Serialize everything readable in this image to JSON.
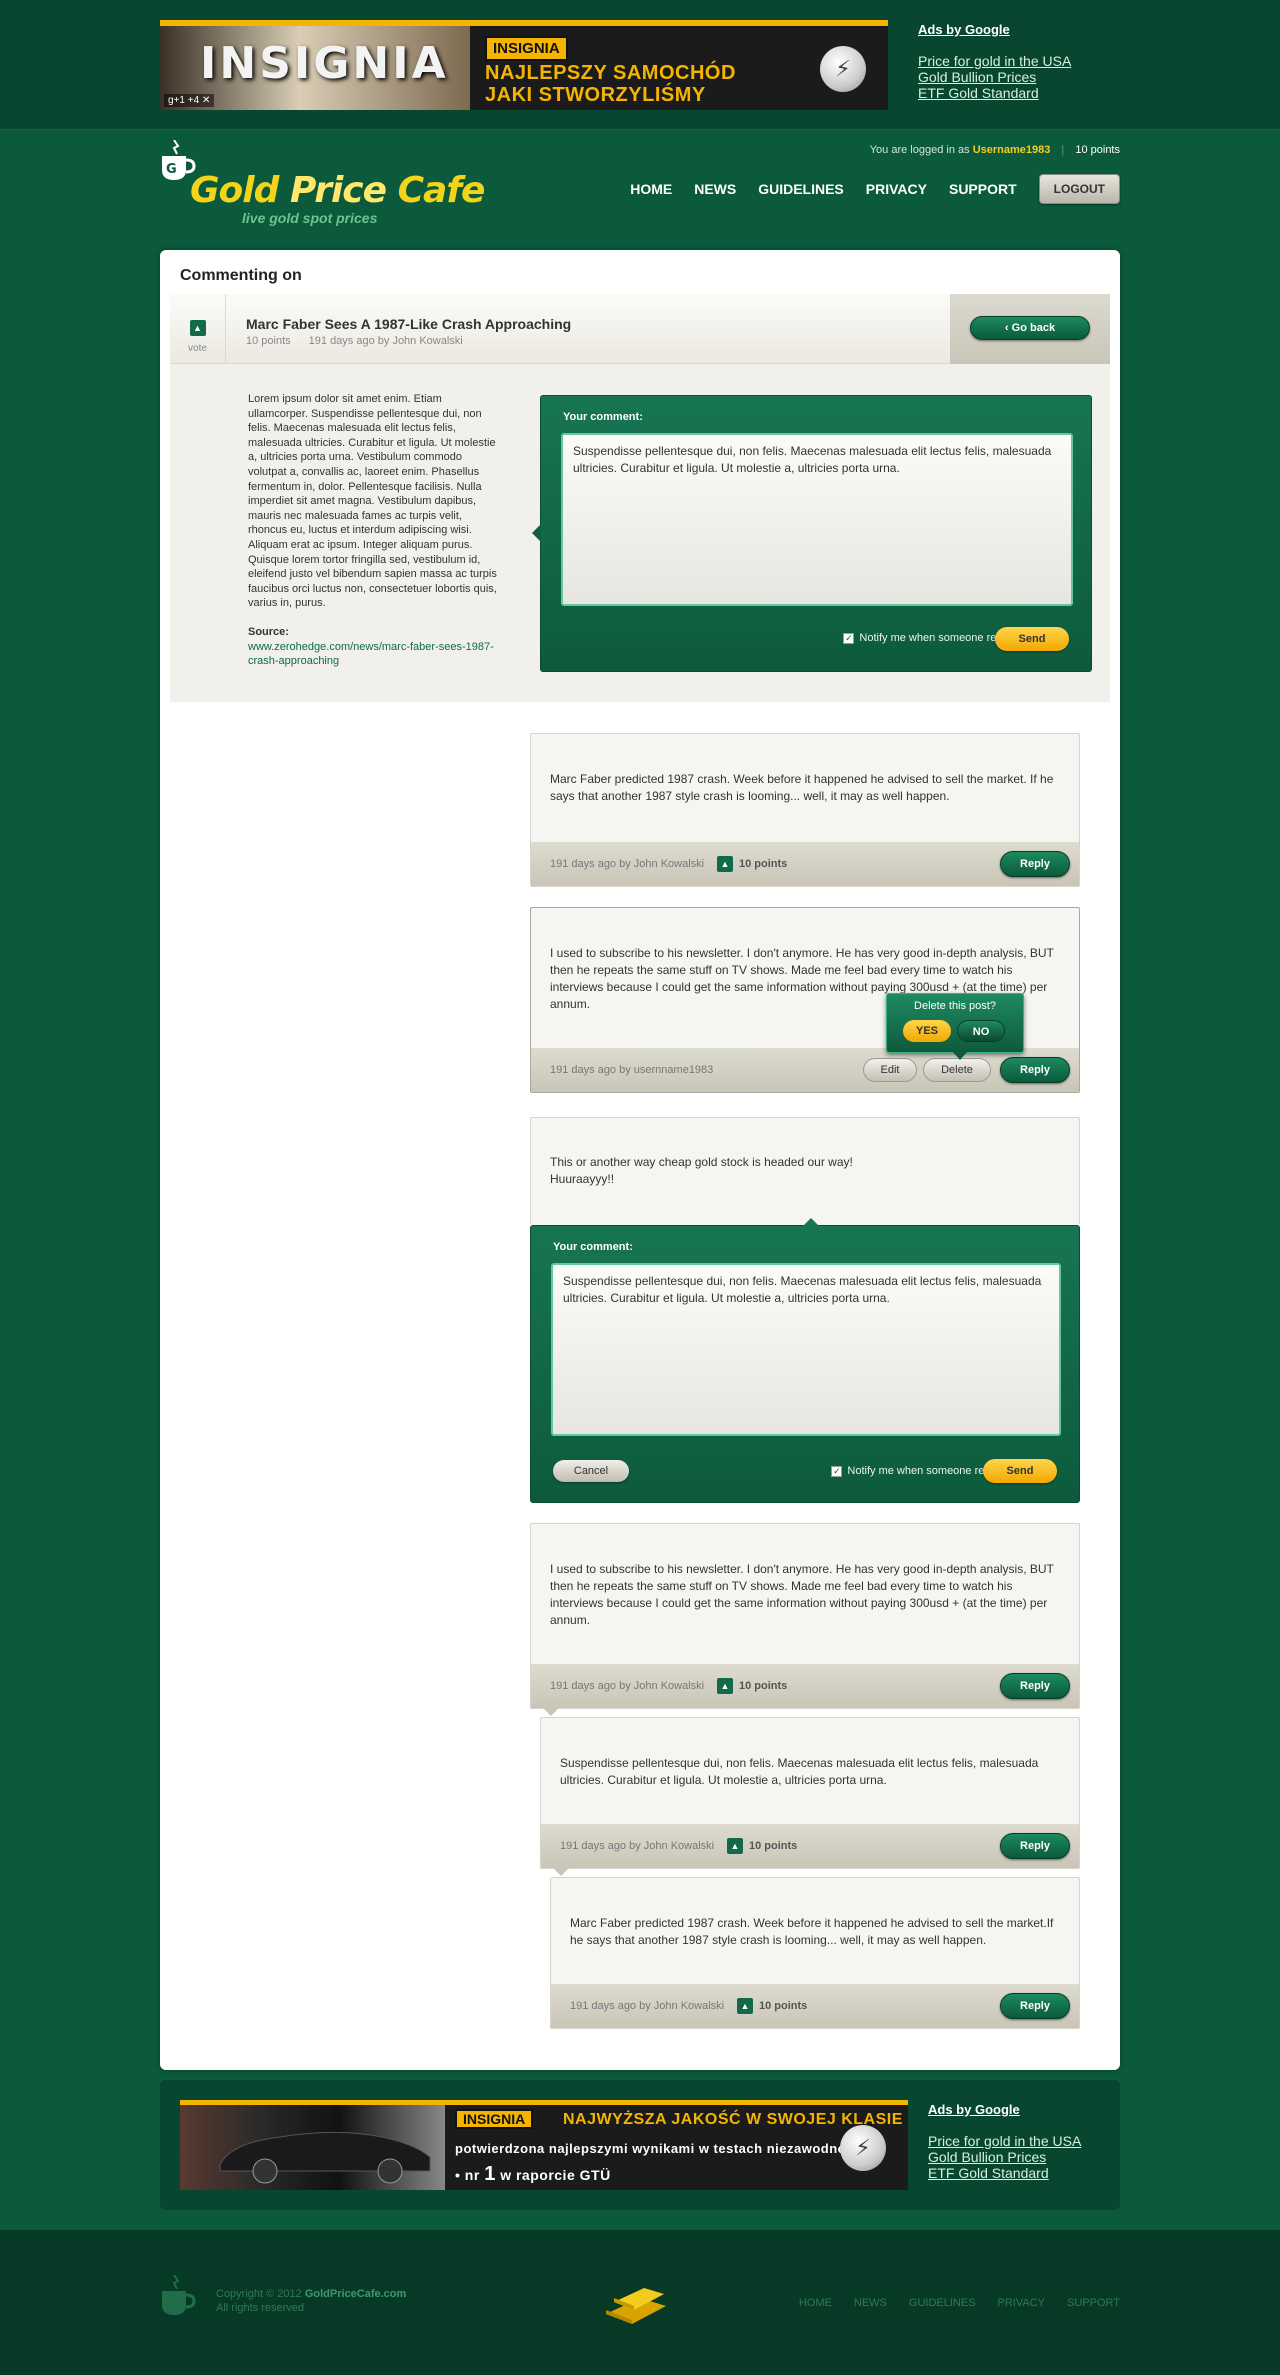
{
  "ads_top": {
    "brand": "INSIGNIA",
    "plus": "+4",
    "line1": "NAJLEPSZY SAMOCHÓD",
    "line2": "JAKI STWORZYLIŚMY",
    "photo_text": "INSIGNIA"
  },
  "ads_google": {
    "title": "Ads by Google",
    "links": [
      "Price for gold in the USA",
      "Gold Bullion Prices",
      "ETF Gold Standard"
    ]
  },
  "header": {
    "logo_word1": "Gold",
    "logo_word2": "Price",
    "logo_word3": "Cafe",
    "tagline": "live gold spot prices",
    "logged_prefix": "You are logged in as",
    "username": "Username1983",
    "points": "10 points",
    "nav": [
      "HOME",
      "NEWS",
      "GUIDELINES",
      "PRIVACY",
      "SUPPORT"
    ],
    "logout": "LOGOUT"
  },
  "article": {
    "page_title": "Commenting on",
    "vote_label": "vote",
    "title": "Marc Faber Sees A 1987-Like Crash Approaching",
    "points": "10 points",
    "meta": "191 days ago by John Kowalski",
    "go_back": "Go back",
    "body": "Lorem ipsum dolor sit amet enim. Etiam ullamcorper. Suspendisse pellentesque dui, non felis. Maecenas malesuada elit lectus felis, malesuada ultricies. Curabitur et ligula. Ut molestie a, ultricies porta urna. Vestibulum commodo volutpat a, convallis ac, laoreet enim. Phasellus fermentum in, dolor. Pellentesque facilisis. Nulla imperdiet sit amet magna. Vestibulum dapibus, mauris nec malesuada fames ac turpis velit, rhoncus eu, luctus et interdum adipiscing wisi. Aliquam erat ac ipsum. Integer aliquam purus. Quisque lorem tortor fringilla sed, vestibulum id, eleifend justo vel bibendum sapien massa ac turpis faucibus orci luctus non, consectetuer lobortis quis, varius in, purus.",
    "source_label": "Source:",
    "source_url": "www.zerohedge.com/news/marc-faber-sees-1987-crash-approaching"
  },
  "form": {
    "label": "Your comment:",
    "text": "Suspendisse pellentesque dui, non felis. Maecenas malesuada elit lectus felis, malesuada ultricies. Curabitur et ligula. Ut molestie a, ultricies porta urna.",
    "notify": "Notify me when someone replies",
    "send": "Send",
    "cancel": "Cancel"
  },
  "comments": [
    {
      "text": "Marc Faber predicted 1987 crash. Week before it happened he advised to sell the market. If he says that another 1987 style crash is looming... well, it may as well happen.",
      "meta": "191 days ago by John Kowalski",
      "points": "10 points",
      "reply": "Reply"
    },
    {
      "text": "I used to subscribe to his newsletter. I don't anymore. He has very good in-depth analysis, BUT then he repeats the same stuff on TV shows. Made me feel bad every time to watch his interviews because I could get the same information without paying 300usd + (at the time) per annum.",
      "meta": "191 days ago by usernname1983",
      "edit": "Edit",
      "delete": "Delete",
      "reply": "Reply",
      "confirm_question": "Delete this post?",
      "confirm_yes": "YES",
      "confirm_no": "NO"
    },
    {
      "text_line1": "This or another way cheap gold stock is headed our way!",
      "text_line2": "Huuraayyy!!"
    },
    {
      "text": "I used to subscribe to his newsletter. I don't anymore. He has very good in-depth analysis, BUT then he repeats the same stuff on TV shows. Made me feel bad every time to watch his interviews because I could get the same information without paying 300usd + (at the time) per annum.",
      "meta": "191 days ago by John Kowalski",
      "points": "10 points",
      "reply": "Reply"
    },
    {
      "text": "Suspendisse pellentesque dui, non felis. Maecenas malesuada elit lectus felis, malesuada ultricies. Curabitur et ligula. Ut molestie a, ultricies porta urna.",
      "meta": "191 days ago by John Kowalski",
      "points": "10 points",
      "reply": "Reply"
    },
    {
      "text": "Marc Faber predicted 1987 crash. Week before it happened he advised to sell the market.If he says that another 1987 style crash is looming... well, it may as well happen.",
      "meta": "191 days ago by John Kowalski",
      "points": "10 points",
      "reply": "Reply"
    }
  ],
  "ads_bottom": {
    "brand": "INSIGNIA",
    "headline": "NAJWYŻSZA JAKOŚĆ W SWOJEJ KLASIE",
    "line2": "potwierdzona najlepszymi wynikami w testach niezawodności :",
    "line3_prefix": "• nr",
    "line3_num": "1",
    "line3_mid": "w raporcie",
    "line3_suffix": "GTÜ"
  },
  "footer": {
    "copyright_prefix": "Copyright © 2012",
    "copyright_site": "GoldPriceCafe.com",
    "rights": "All rights reserved",
    "nav": [
      "HOME",
      "NEWS",
      "GUIDELINES",
      "PRIVACY",
      "SUPPORT"
    ]
  },
  "colors": {
    "background": "#0b5a3c",
    "accent_yellow": "#f4b400",
    "button_green": "#116b48",
    "logo_yellow": "#f3d41a"
  }
}
